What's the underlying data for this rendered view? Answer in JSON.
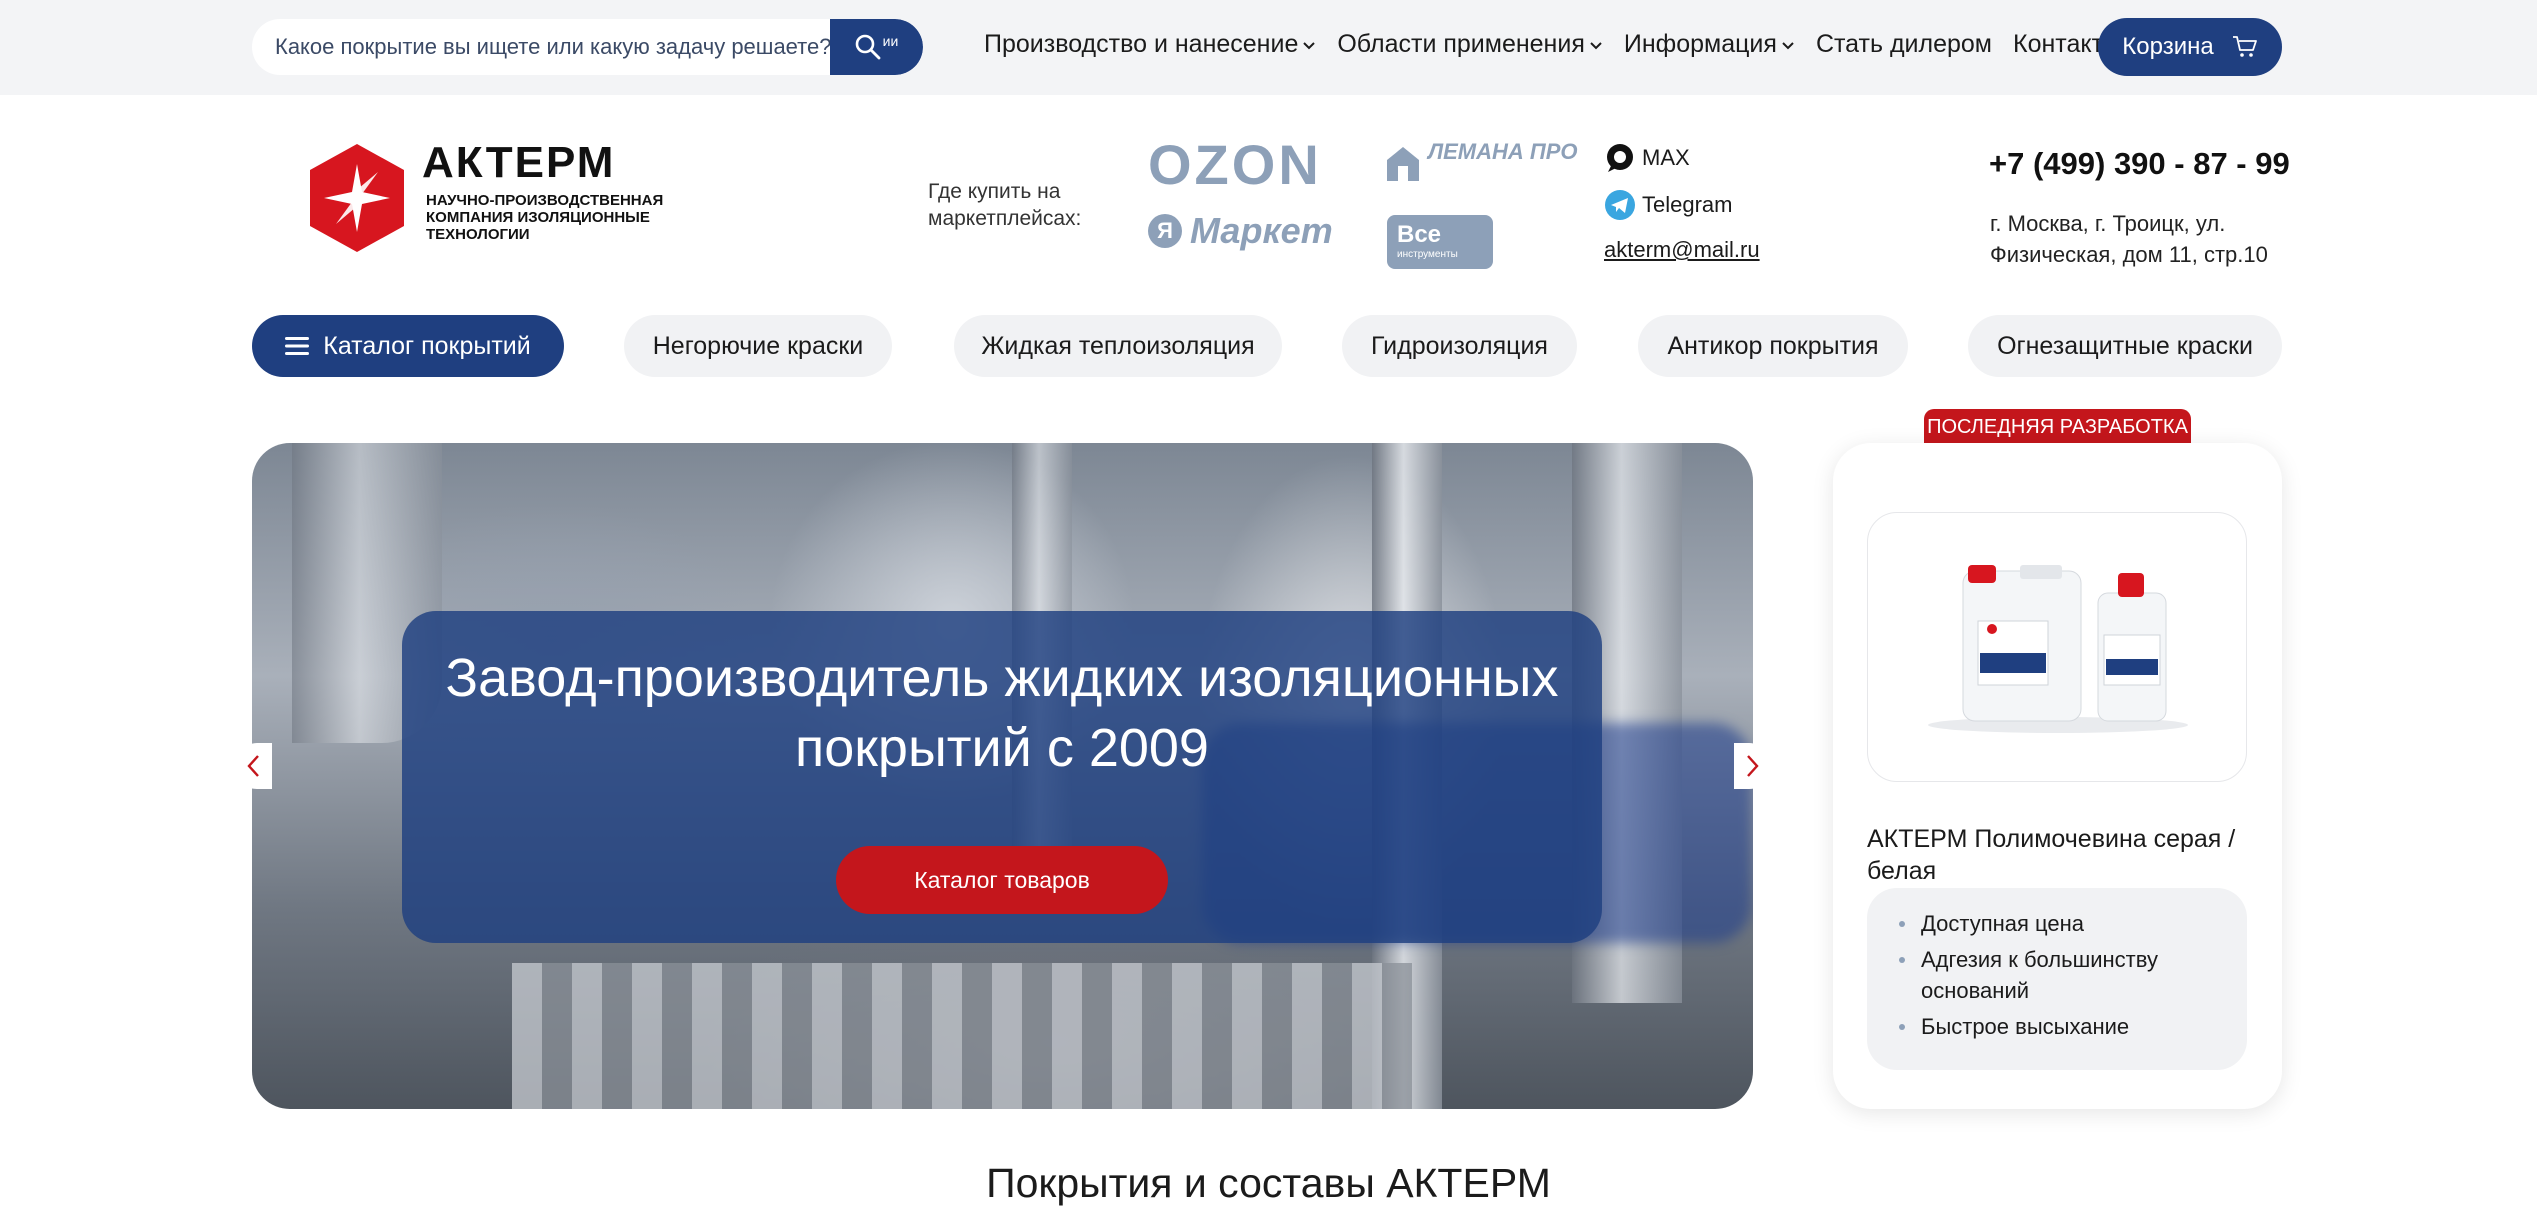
{
  "search": {
    "placeholder": "Какое покрытие вы ищете или какую задачу решаете?",
    "ai_label": "ии"
  },
  "topnav": [
    {
      "label": "Производство и нанесение",
      "has_dropdown": true
    },
    {
      "label": "Области применения",
      "has_dropdown": true
    },
    {
      "label": "Информация",
      "has_dropdown": true
    },
    {
      "label": "Стать дилером",
      "has_dropdown": false
    },
    {
      "label": "Контакты",
      "has_dropdown": false
    }
  ],
  "cart": {
    "label": "Корзина"
  },
  "logo": {
    "name": "АКТЕРМ",
    "subtitle": "Научно-производственная компания изоляционные технологии"
  },
  "marketplaces": {
    "label": "Где купить на маркетплейсах:",
    "ozon": "OZON",
    "lemana": "ЛЕМАНА ПРО",
    "yandex_letter": "Я",
    "yandex": "Маркет",
    "vse": "Все",
    "vse_sub": "инструменты"
  },
  "contacts": {
    "max": "MAX",
    "telegram": "Telegram",
    "email": "akterm@mail.ru"
  },
  "phone": "+7 (499) 390 - 87 - 99",
  "address": "г. Москва, г. Троицк, ул. Физическая, дом 11, стр.10",
  "categories": {
    "catalog_label": "Каталог покрытий",
    "items": [
      "Негорючие краски",
      "Жидкая теплоизоляция",
      "Гидроизоляция",
      "Антикор покрытия",
      "Огнезащитные краски"
    ]
  },
  "hero": {
    "title": "Завод-производитель жидких изоляционных покрытий с 2009",
    "cta": "Каталог товаров"
  },
  "product": {
    "badge": "ПОСЛЕДНЯЯ РАЗРАБОТКА",
    "name": "АКТЕРМ Полимочевина серая / белая",
    "features": [
      "Доступная цена",
      "Адгезия к большинству оснований",
      "Быстрое высыхание"
    ]
  },
  "section_title": "Покрытия и составы АКТЕРМ",
  "colors": {
    "primary": "#1f3f80",
    "accent": "#c4161c",
    "muted": "#8da0b8",
    "bg_light": "#f3f4f6"
  }
}
